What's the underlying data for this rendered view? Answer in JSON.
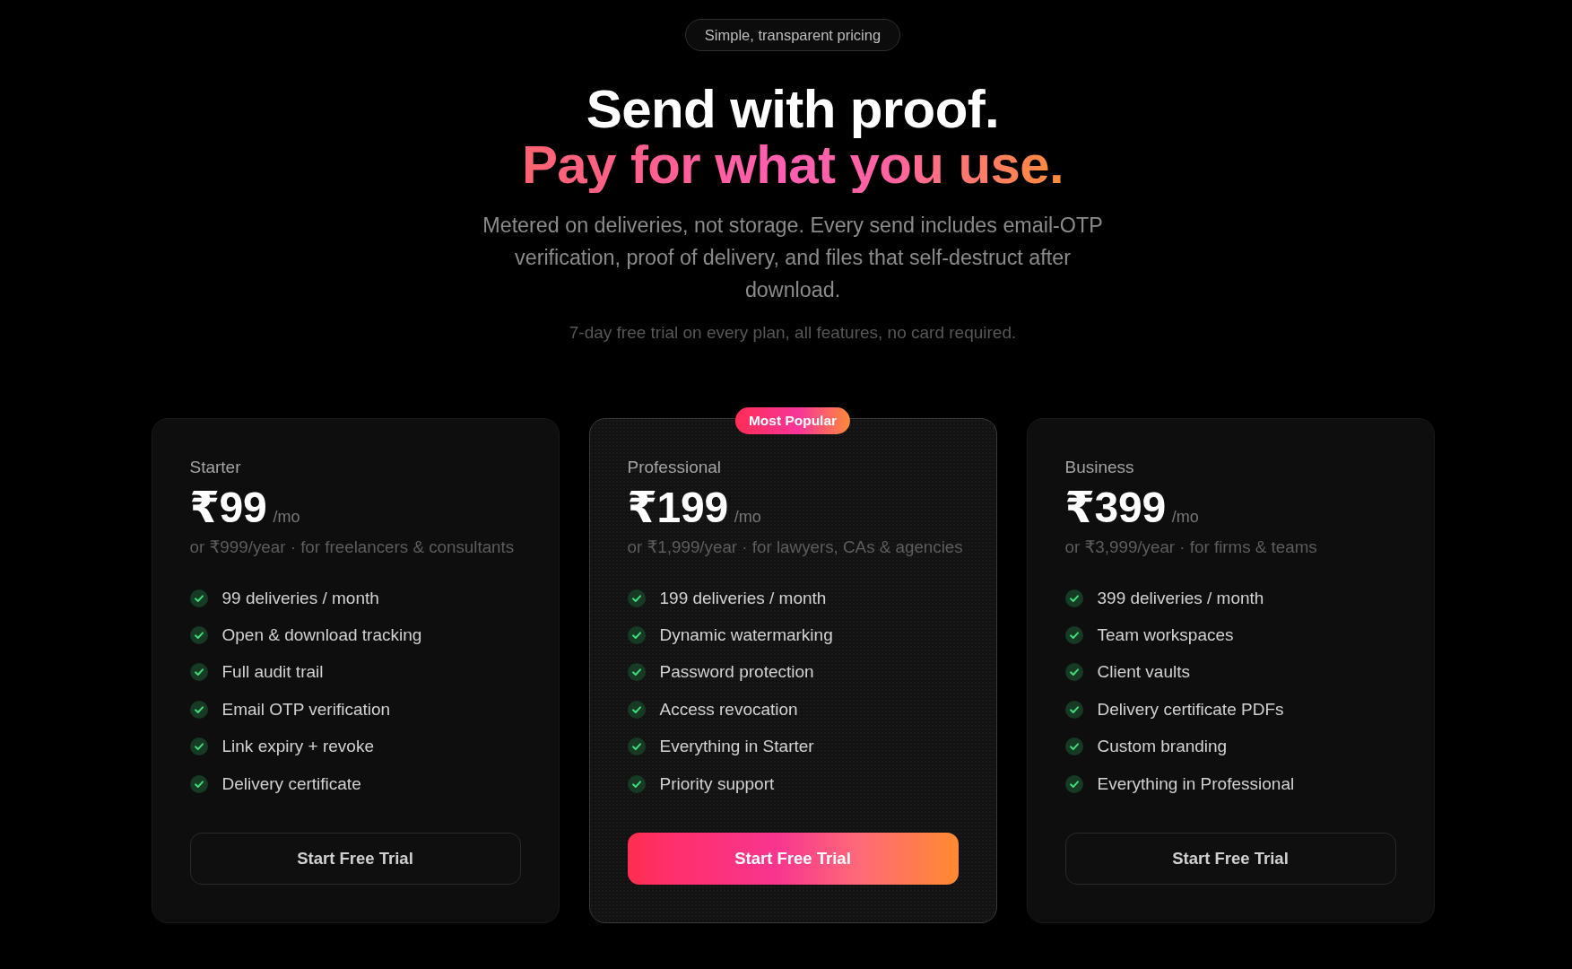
{
  "tagline": "Simple, transparent pricing",
  "headline": {
    "line_1": "Send with proof.",
    "line_2": "Pay for what you use."
  },
  "description": "Metered on deliveries, not storage. Every send includes email-OTP verification, proof of delivery, and files that self-destruct after download.",
  "trial_note": "7-day free trial on every plan, all features, no card required.",
  "plans": [
    {
      "name": "Starter",
      "price": "₹99",
      "period": "/mo",
      "subtitle": "or ₹999/year · for freelancers & consultants",
      "highlighted": false,
      "features": [
        "99 deliveries / month",
        "Open & download tracking",
        "Full audit trail",
        "Email OTP verification",
        "Link expiry + revoke",
        "Delivery certificate"
      ],
      "button": "Start Free Trial"
    },
    {
      "name": "Professional",
      "badge": "Most Popular",
      "price": "₹199",
      "period": "/mo",
      "subtitle": "or ₹1,999/year · for lawyers, CAs & agencies",
      "highlighted": true,
      "features": [
        "199 deliveries / month",
        "Dynamic watermarking",
        "Password protection",
        "Access revocation",
        "Everything in Starter",
        "Priority support"
      ],
      "button": "Start Free Trial"
    },
    {
      "name": "Business",
      "price": "₹399",
      "period": "/mo",
      "subtitle": "or ₹3,999/year · for firms & teams",
      "highlighted": false,
      "features": [
        "399 deliveries / month",
        "Team workspaces",
        "Client vaults",
        "Delivery certificate PDFs",
        "Custom branding",
        "Everything in Professional"
      ],
      "button": "Start Free Trial"
    }
  ]
}
